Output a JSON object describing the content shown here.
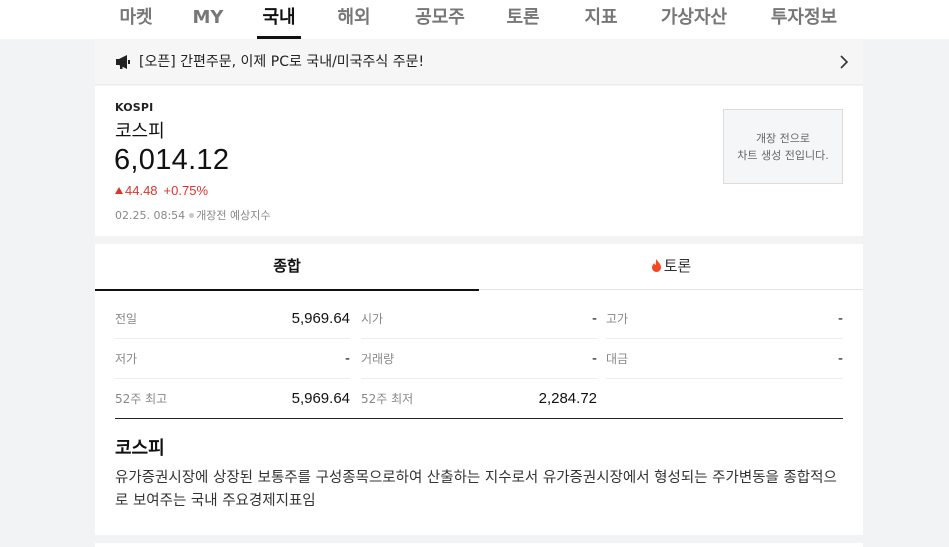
{
  "nav": {
    "items": [
      {
        "label": "마켓"
      },
      {
        "label": "MY"
      },
      {
        "label": "국내"
      },
      {
        "label": "해외"
      },
      {
        "label": "공모주"
      },
      {
        "label": "토론"
      },
      {
        "label": "지표"
      },
      {
        "label": "가상자산"
      },
      {
        "label": "투자정보"
      }
    ],
    "active": "국내"
  },
  "notice": {
    "text": "[오픈] 간편주문, 이제 PC로 국내/미국주식 주문!",
    "icon": "megaphone-icon"
  },
  "index": {
    "code": "KOSPI",
    "name": "코스피",
    "value": "6,014.12",
    "change": "44.48",
    "change_pct": "+0.75%",
    "direction": "up",
    "time": "02.25. 08:54",
    "status": "개장전 예상지수",
    "chart_message_line1": "개장 전으로",
    "chart_message_line2": "차트 생성 전입니다."
  },
  "tabs": [
    {
      "label": "종합"
    },
    {
      "label": "토론"
    }
  ],
  "stats": {
    "prev_close": {
      "label": "전일",
      "value": "5,969.64"
    },
    "open": {
      "label": "시가",
      "value": "-"
    },
    "high": {
      "label": "고가",
      "value": "-"
    },
    "low": {
      "label": "저가",
      "value": "-"
    },
    "volume": {
      "label": "거래량",
      "value": "-"
    },
    "amount": {
      "label": "대금",
      "value": "-"
    },
    "week52_high": {
      "label": "52주 최고",
      "value": "5,969.64"
    },
    "week52_low": {
      "label": "52주 최저",
      "value": "2,284.72"
    }
  },
  "description": {
    "title": "코스피",
    "text": "유가증권시장에 상장된 보통주를 구성종목으로하여 산출하는 지수로서 유가증권시장에서 형성되는 주가변동을 종합적으로 보여주는 국내 주요경제지표임"
  },
  "colors": {
    "up": "#e0322c",
    "background": "#f2f3f5",
    "accent": "#111111"
  }
}
